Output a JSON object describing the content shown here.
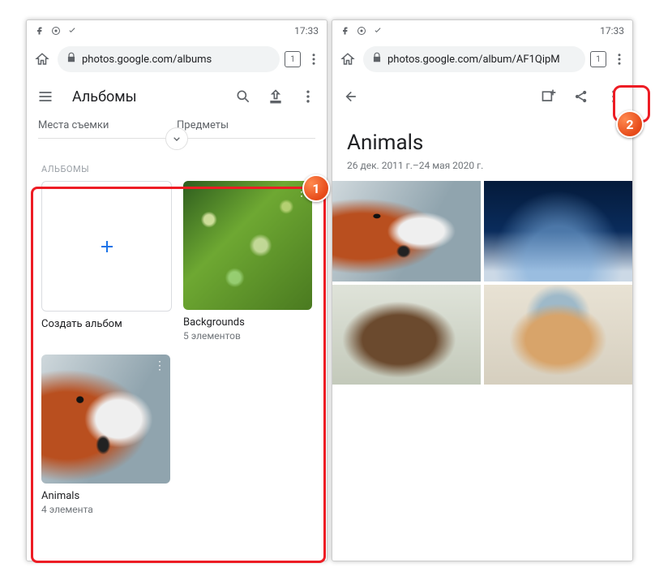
{
  "status_time": "17:33",
  "left": {
    "url": "photos.google.com/albums",
    "tabs": "1",
    "app_title": "Альбомы",
    "section_left": "Места съемки",
    "section_right": "Предметы",
    "section_label": "АЛЬБОМЫ",
    "albums": {
      "create": "Создать альбом",
      "card1": {
        "title": "Backgrounds",
        "count": "5 элементов"
      },
      "card2": {
        "title": "Animals",
        "count": "4 элемента"
      }
    }
  },
  "right": {
    "url": "photos.google.com/album/AF1QipM",
    "tabs": "1",
    "album_title": "Animals",
    "date_range": "26 дек. 2011 г.–24 мая 2020 г."
  },
  "badge1": "1",
  "badge2": "2"
}
